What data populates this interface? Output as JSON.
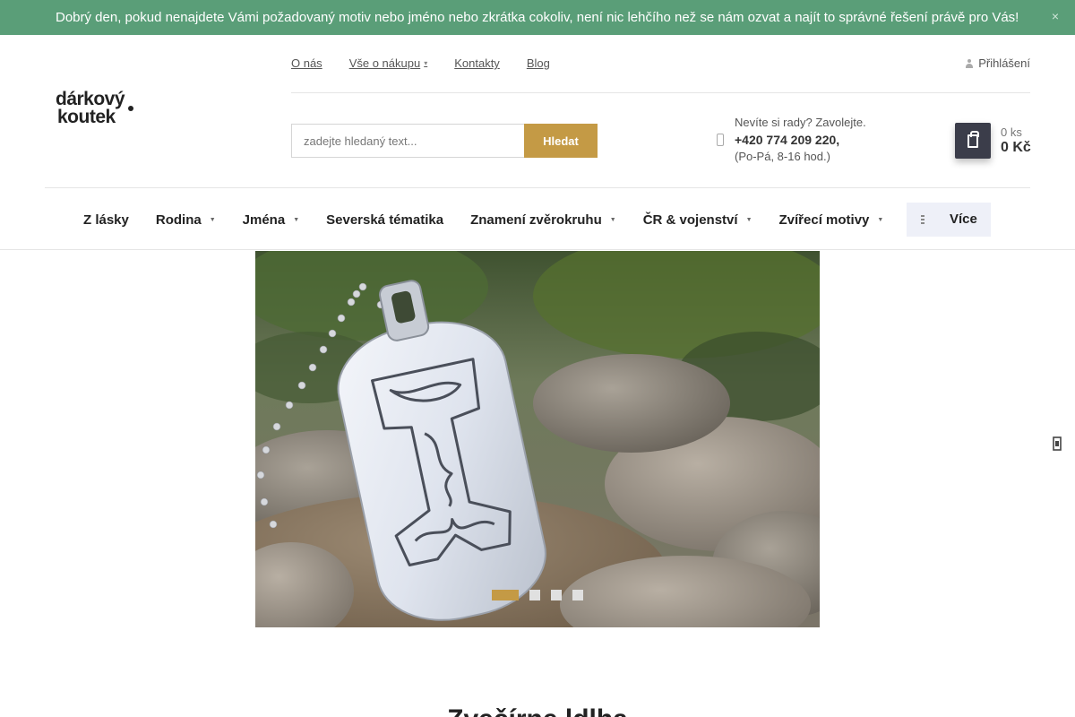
{
  "banner": {
    "text": "Dobrý den, pokud nenajdete Vámi požadovaný motiv nebo jméno nebo zkrátka cokoliv, není nic lehčího než se nám ozvat a najít to správné řešení právě pro Vás!",
    "close": "×"
  },
  "logo": {
    "line1": "dárkový",
    "line2": "koutek"
  },
  "topnav": {
    "items": [
      "O nás",
      "Vše o nákupu",
      "Kontakty",
      "Blog"
    ]
  },
  "login": {
    "label": "Přihlášení"
  },
  "search": {
    "placeholder": "zadejte hledaný text...",
    "button": "Hledat"
  },
  "contact": {
    "prompt": "Nevíte si rady? Zavolejte.",
    "phone": "+420 774 209 220,",
    "hours": "(Po-Pá, 8-16 hod.)"
  },
  "cart": {
    "count": "0 ks",
    "price": "0 Kč"
  },
  "mainnav": {
    "items": [
      {
        "label": "Z lásky",
        "has_submenu": false
      },
      {
        "label": "Rodina",
        "has_submenu": true
      },
      {
        "label": "Jména",
        "has_submenu": true
      },
      {
        "label": "Severská tématika",
        "has_submenu": false
      },
      {
        "label": "Znamení zvěrokruhu",
        "has_submenu": true
      },
      {
        "label": "ČR & vojenství",
        "has_submenu": true
      },
      {
        "label": "Zvířecí motivy",
        "has_submenu": true
      }
    ],
    "more": "Více"
  },
  "slider": {
    "slide_count": 4,
    "active_slide": 1
  },
  "section": {
    "heading": "Zvečírne ldlha"
  },
  "colors": {
    "banner_bg": "#5a9e78",
    "accent": "#c49a45",
    "cart_button": "#3b3d4a",
    "more_button_bg": "#eef0f8"
  },
  "icons": {
    "login": "user-icon",
    "phone": "phone-icon",
    "cart": "shopping-bag-icon",
    "more": "hamburger-icon",
    "side": "chevron-right-icon"
  }
}
